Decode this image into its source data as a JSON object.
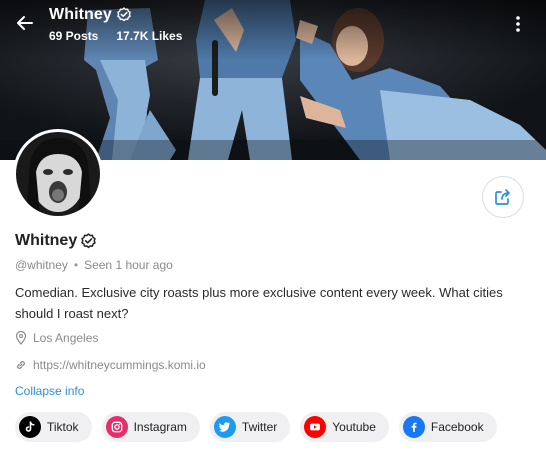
{
  "header": {
    "title": "Whitney",
    "posts": "69 Posts",
    "likes": "17.7K Likes"
  },
  "profile": {
    "name": "Whitney",
    "handle": "@whitney",
    "separator": "•",
    "last_seen": "Seen 1 hour ago",
    "bio": "Comedian. Exclusive city roasts plus more exclusive content every week. What cities should I roast next?",
    "location": "Los Angeles",
    "website": "https://whitneycummings.komi.io",
    "collapse_label": "Collapse info"
  },
  "socials": [
    {
      "label": "Tiktok",
      "icon": "tiktok-icon",
      "color": "#000000"
    },
    {
      "label": "Instagram",
      "icon": "instagram-icon",
      "color": "#e1306c"
    },
    {
      "label": "Twitter",
      "icon": "twitter-icon",
      "color": "#1d9bf0"
    },
    {
      "label": "Youtube",
      "icon": "youtube-icon",
      "color": "#ff0000"
    },
    {
      "label": "Facebook",
      "icon": "facebook-icon",
      "color": "#1877f2"
    }
  ],
  "colors": {
    "accent": "#2f8fd8",
    "chip_bg": "#f0f0f2",
    "muted_text": "#8a8a8a"
  }
}
